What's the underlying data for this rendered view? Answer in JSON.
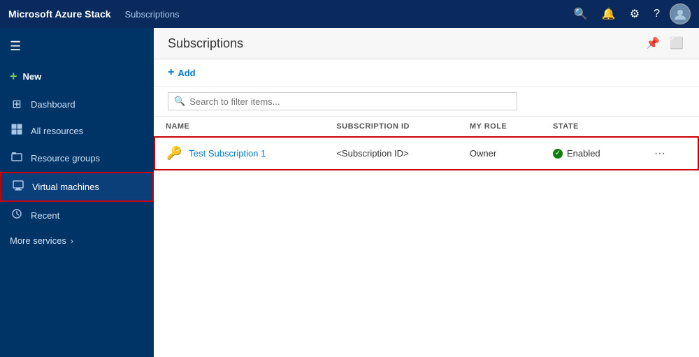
{
  "app": {
    "brand": "Microsoft Azure Stack",
    "header_tab": "Subscriptions",
    "page_title": "Subscriptions"
  },
  "header_icons": {
    "search": "🔍",
    "bell": "🔔",
    "settings": "⚙",
    "help": "?"
  },
  "sidebar": {
    "hamburger": "☰",
    "new_label": "New",
    "items": [
      {
        "id": "dashboard",
        "label": "Dashboard",
        "icon": "⊞",
        "active": false
      },
      {
        "id": "all-resources",
        "label": "All resources",
        "icon": "⧉",
        "active": false
      },
      {
        "id": "resource-groups",
        "label": "Resource groups",
        "icon": "◫",
        "active": false
      },
      {
        "id": "virtual-machines",
        "label": "Virtual machines",
        "icon": "🖥",
        "active": true
      },
      {
        "id": "recent",
        "label": "Recent",
        "icon": "⏱",
        "active": false
      }
    ],
    "more_services": "More services"
  },
  "content": {
    "title": "Subscriptions",
    "toolbar": {
      "add_label": "Add",
      "add_icon": "+"
    },
    "search_placeholder": "Search to filter items...",
    "table": {
      "columns": [
        "NAME",
        "SUBSCRIPTION ID",
        "MY ROLE",
        "STATE"
      ],
      "rows": [
        {
          "name": "Test Subscription 1",
          "subscription_id": "<Subscription ID>",
          "role": "Owner",
          "state": "Enabled",
          "highlighted": true
        }
      ]
    }
  }
}
